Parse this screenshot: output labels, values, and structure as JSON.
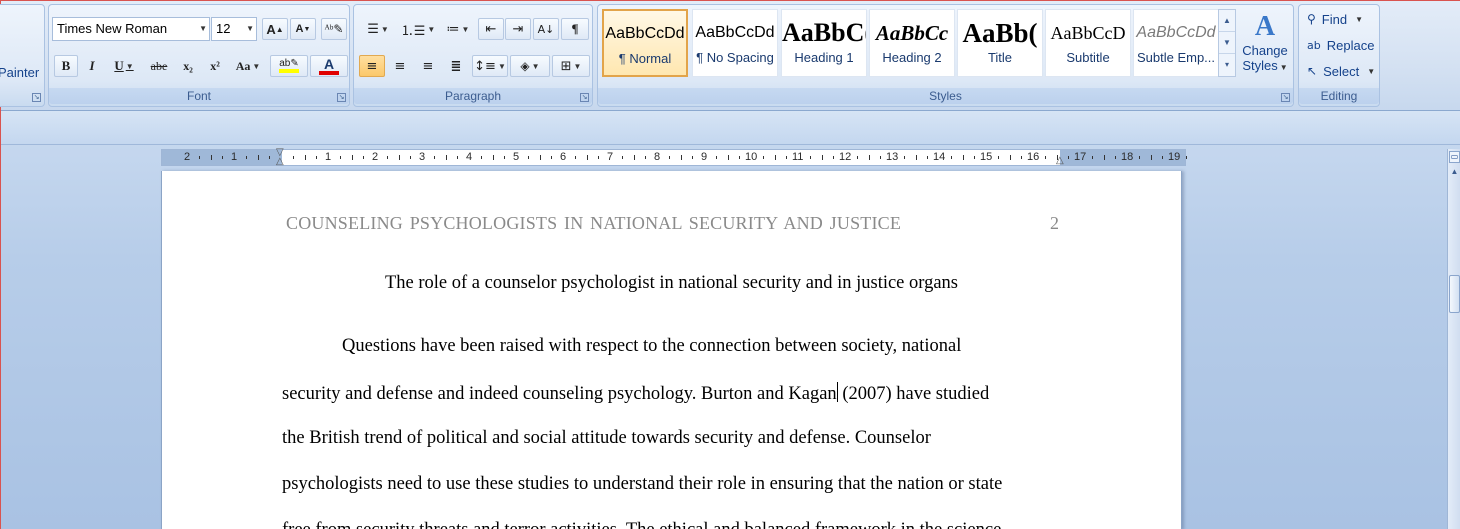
{
  "clipboard": {
    "painter_label": "Painter"
  },
  "font": {
    "group_label": "Font",
    "name": "Times New Roman",
    "size": "12",
    "grow_label": "A",
    "shrink_label": "A",
    "bold": "B",
    "italic": "I",
    "underline": "U",
    "strikethrough": "abe",
    "subscript": "x₂",
    "superscript": "x²",
    "change_case": "Aa",
    "highlight_color": "#ffff00",
    "font_color": "#e00000"
  },
  "paragraph": {
    "group_label": "Paragraph"
  },
  "styles": {
    "group_label": "Styles",
    "items": [
      {
        "sample": "AaBbCcDd",
        "name": "¶ Normal"
      },
      {
        "sample": "AaBbCcDd",
        "name": "¶ No Spacing"
      },
      {
        "sample": "AaBbC(",
        "name": "Heading 1"
      },
      {
        "sample": "AaBbCc",
        "name": "Heading 2"
      },
      {
        "sample": "AaBb(",
        "name": "Title"
      },
      {
        "sample": "AaBbCcD",
        "name": "Subtitle"
      },
      {
        "sample": "AaBbCcDd",
        "name": "Subtle Emp..."
      }
    ],
    "change_styles_line1": "Change",
    "change_styles_line2": "Styles"
  },
  "editing": {
    "group_label": "Editing",
    "find": "Find",
    "replace": "Replace",
    "select": "Select"
  },
  "ruler": {
    "labels": [
      "2",
      "1",
      "1",
      "2",
      "3",
      "4",
      "5",
      "6",
      "7",
      "8",
      "9",
      "10",
      "11",
      "12",
      "13",
      "14",
      "15",
      "16",
      "17",
      "18",
      "19"
    ]
  },
  "document": {
    "running_head": "COUNSELING PSYCHOLOGISTS IN NATIONAL SECURITY AND JUSTICE",
    "page_number": "2",
    "title": "The role of a counselor psychologist in national security and in justice organs",
    "lines": [
      "Questions have been raised with respect to the connection between society, national",
      "security and defense and indeed counseling psychology. Burton and Kagan",
      "(2007) have studied",
      "the British trend of political and social attitude towards security and defense. Counselor",
      "psychologists need to use these studies to understand their role in ensuring that the nation or state",
      "free from security threats and terror activities. The ethical and balanced framework in the science"
    ]
  }
}
